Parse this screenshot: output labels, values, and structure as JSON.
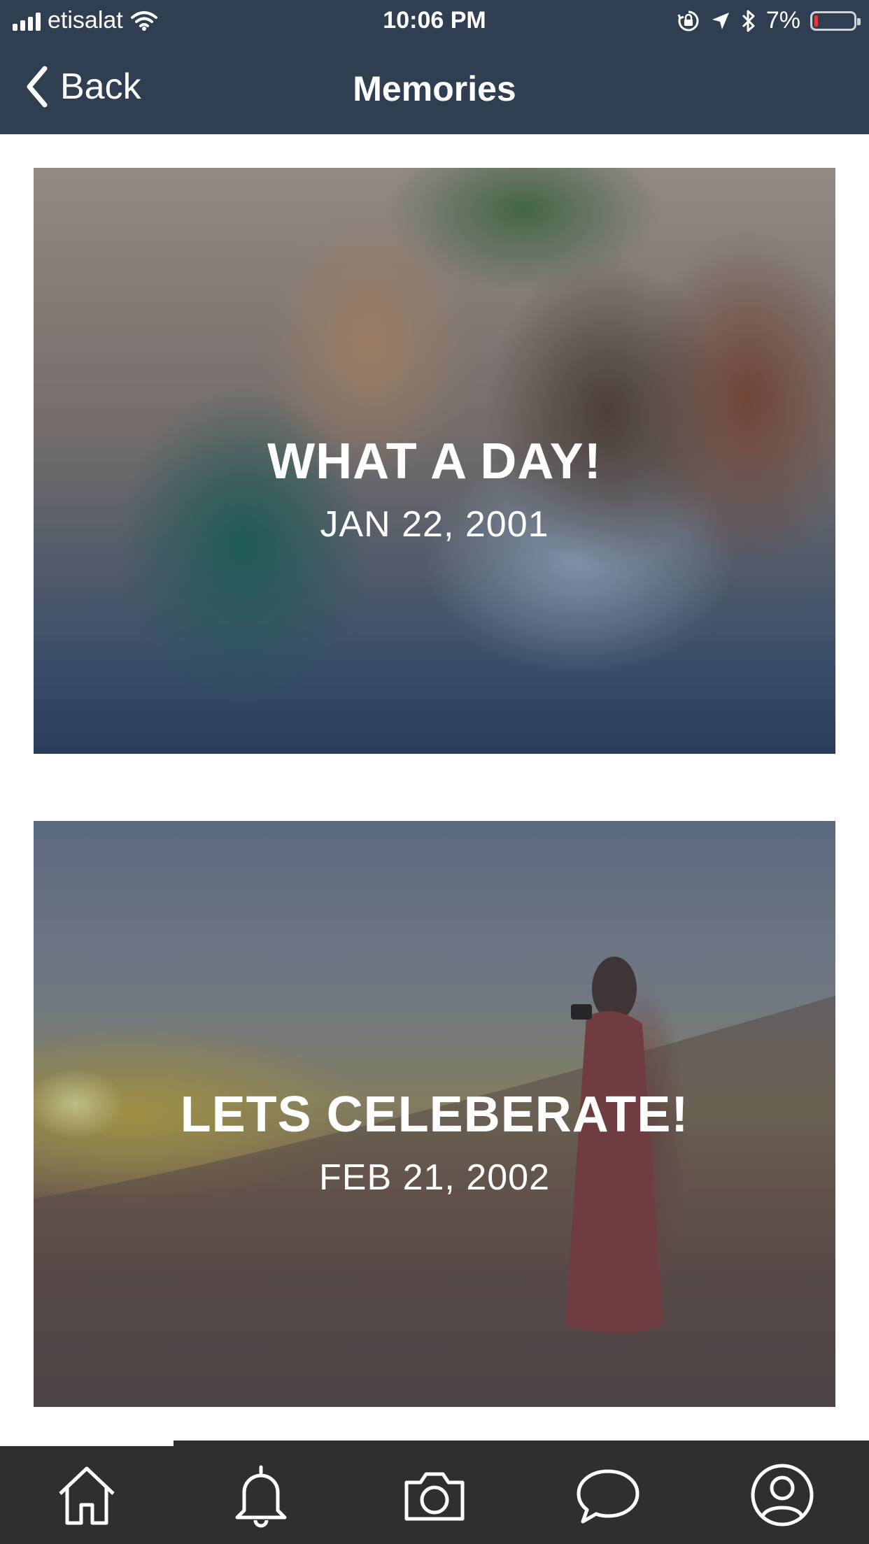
{
  "status_bar": {
    "carrier": "etisalat",
    "time": "10:06 PM",
    "battery_percent": "7%",
    "icons": [
      "signal-icon",
      "wifi-icon",
      "orientation-lock-icon",
      "location-icon",
      "bluetooth-icon",
      "battery-icon"
    ]
  },
  "nav": {
    "back_label": "Back",
    "title": "Memories"
  },
  "memories": [
    {
      "title": "WHAT A DAY!",
      "date": "JAN 22, 2001"
    },
    {
      "title": "LETS CELEBERATE!",
      "date": "FEB 21, 2002"
    }
  ],
  "tab_bar": {
    "selected_index": 0,
    "tabs": [
      "home-icon",
      "bell-icon",
      "camera-icon",
      "chat-icon",
      "profile-icon"
    ]
  },
  "colors": {
    "nav_background": "#2f3e50",
    "tab_background": "#2f2e31",
    "text": "#ffffff",
    "battery_low": "#e53935"
  }
}
